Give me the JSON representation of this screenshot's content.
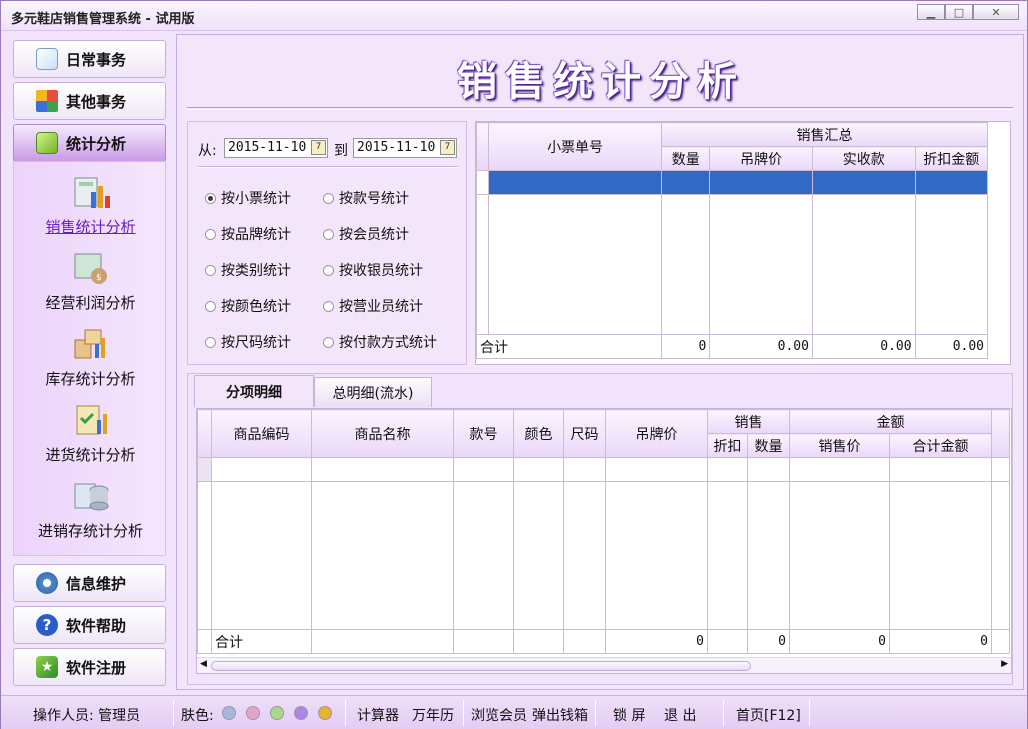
{
  "window": {
    "title": "多元鞋店销售管理系统 - 试用版",
    "min": "▁",
    "max": "□",
    "close": "✕"
  },
  "sidebar": {
    "buttons_top": [
      {
        "label": "日常事务",
        "icon": "notebook-pencil-icon"
      },
      {
        "label": "其他事务",
        "icon": "four-squares-icon"
      },
      {
        "label": "统计分析",
        "icon": "cube-icon"
      }
    ],
    "sub_items": [
      {
        "label": "销售统计分析",
        "icon": "sales-chart-icon"
      },
      {
        "label": "经营利润分析",
        "icon": "money-bag-icon"
      },
      {
        "label": "库存统计分析",
        "icon": "inventory-boxes-icon"
      },
      {
        "label": "进货统计分析",
        "icon": "clipboard-check-icon"
      },
      {
        "label": "进销存统计分析",
        "icon": "database-chart-icon"
      }
    ],
    "buttons_bottom": [
      {
        "label": "信息维护",
        "icon": "gears-icon"
      },
      {
        "label": "软件帮助",
        "icon": "help-circle-icon"
      },
      {
        "label": "软件注册",
        "icon": "star-register-icon"
      }
    ]
  },
  "main": {
    "title": "销售统计分析",
    "filter": {
      "from_label": "从:",
      "from_date": "2015-11-10",
      "to_label": "到",
      "to_date": "2015-11-10",
      "options": [
        {
          "label": "按小票统计",
          "checked": true
        },
        {
          "label": "按款号统计",
          "checked": false
        },
        {
          "label": "按品牌统计",
          "checked": false
        },
        {
          "label": "按会员统计",
          "checked": false
        },
        {
          "label": "按类别统计",
          "checked": false
        },
        {
          "label": "按收银员统计",
          "checked": false
        },
        {
          "label": "按颜色统计",
          "checked": false
        },
        {
          "label": "按营业员统计",
          "checked": false
        },
        {
          "label": "按尺码统计",
          "checked": false
        },
        {
          "label": "按付款方式统计",
          "checked": false
        }
      ]
    },
    "summary_grid": {
      "col_ticket": "小票单号",
      "group_label": "销售汇总",
      "cols": [
        "数量",
        "吊牌价",
        "实收款",
        "折扣金额"
      ],
      "total_label": "合计",
      "totals": [
        "0",
        "0.00",
        "0.00",
        "0.00"
      ]
    },
    "tabs": [
      "分项明细",
      "总明细(流水)"
    ],
    "detail_grid": {
      "cols": [
        "商品编码",
        "商品名称",
        "款号",
        "颜色",
        "尺码",
        "吊牌价"
      ],
      "group_sale": "销售",
      "sale_cols": [
        "折扣",
        "数量"
      ],
      "group_amount": "金额",
      "amount_cols": [
        "销售价",
        "合计金额"
      ],
      "total_label": "合计",
      "totals": [
        "0",
        "0",
        "0",
        "0"
      ]
    }
  },
  "statusbar": {
    "operator": "操作人员: 管理员",
    "skin_label": "肤色:",
    "skins": [
      "#a8b6e0",
      "#e7a1cf",
      "#a9d98a",
      "#b184e8",
      "#e8b232"
    ],
    "calculator": "计算器",
    "calendar": "万年历",
    "browse_members": "浏览会员",
    "open_drawer": "弹出钱箱",
    "lock": "锁 屏",
    "exit": "退 出",
    "home": "首页[F12]"
  },
  "colors": {
    "accent": "#b88ae0",
    "selection": "#316ac5"
  }
}
